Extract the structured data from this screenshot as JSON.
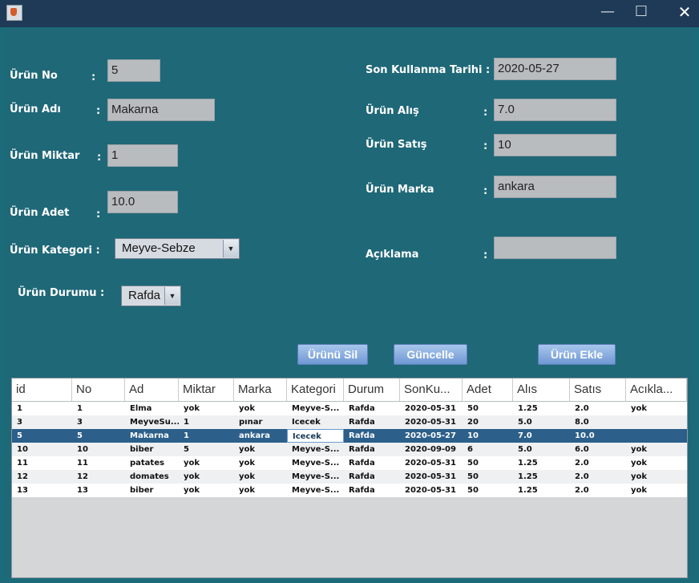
{
  "window": {
    "icon": "java-cup-icon",
    "minimize": "—",
    "maximize": "☐",
    "close": "✕"
  },
  "form": {
    "urun_no": {
      "label": "Ürün No",
      "colon": ":",
      "value": "5"
    },
    "urun_adi": {
      "label": "Ürün Adı",
      "colon": ":",
      "value": "Makarna"
    },
    "urun_miktar": {
      "label": "Ürün Miktar",
      "colon": ":",
      "value": "1"
    },
    "urun_adet": {
      "label": "Ürün Adet",
      "colon": ":",
      "value": "10.0"
    },
    "urun_kategori": {
      "label": "Ürün Kategori :",
      "value": "Meyve-Sebze"
    },
    "urun_durumu": {
      "label": "Ürün Durumu :",
      "value": "Rafda"
    },
    "son_kullanma": {
      "label": "Son Kullanma Tarihi :",
      "value": "2020-05-27"
    },
    "urun_alis": {
      "label": "Ürün Alış",
      "colon": ":",
      "value": "7.0"
    },
    "urun_satis": {
      "label": "Ürün Satış",
      "colon": ":",
      "value": "10"
    },
    "urun_marka": {
      "label": "Ürün Marka",
      "colon": ":",
      "value": "ankara"
    },
    "aciklama": {
      "label": "Açıklama",
      "colon": ":",
      "value": ""
    }
  },
  "buttons": {
    "sil": "Ürünü Sil",
    "guncelle": "Güncelle",
    "ekle": "Ürün Ekle"
  },
  "table": {
    "columns": [
      "id",
      "No",
      "Ad",
      "Miktar",
      "Marka",
      "Kategori",
      "Durum",
      "SonKu...",
      "Adet",
      "Alıs",
      "Satıs",
      "Acıkla..."
    ],
    "rows": [
      [
        "1",
        "1",
        "Elma",
        "yok",
        "yok",
        "Meyve-S...",
        "Rafda",
        "2020-05-31",
        "50",
        "1.25",
        "2.0",
        "yok"
      ],
      [
        "3",
        "3",
        "MeyveSu...",
        "1",
        "pınar",
        "Icecek",
        "Rafda",
        "2020-05-31",
        "20",
        "5.0",
        "8.0",
        ""
      ],
      [
        "5",
        "5",
        "Makarna",
        "1",
        "ankara",
        "Icecek",
        "Rafda",
        "2020-05-27",
        "10",
        "7.0",
        "10.0",
        ""
      ],
      [
        "10",
        "10",
        "biber",
        "5",
        "yok",
        "Meyve-S...",
        "Rafda",
        "2020-09-09",
        "6",
        "5.0",
        "6.0",
        "yok"
      ],
      [
        "11",
        "11",
        "patates",
        "yok",
        "yok",
        "Meyve-S...",
        "Rafda",
        "2020-05-31",
        "50",
        "1.25",
        "2.0",
        "yok"
      ],
      [
        "12",
        "12",
        "domates",
        "yok",
        "yok",
        "Meyve-S...",
        "Rafda",
        "2020-05-31",
        "50",
        "1.25",
        "2.0",
        "yok"
      ],
      [
        "13",
        "13",
        "biber",
        "yok",
        "yok",
        "Meyve-S...",
        "Rafda",
        "2020-05-31",
        "50",
        "1.25",
        "2.0",
        "yok"
      ]
    ],
    "selected_row": 2
  }
}
